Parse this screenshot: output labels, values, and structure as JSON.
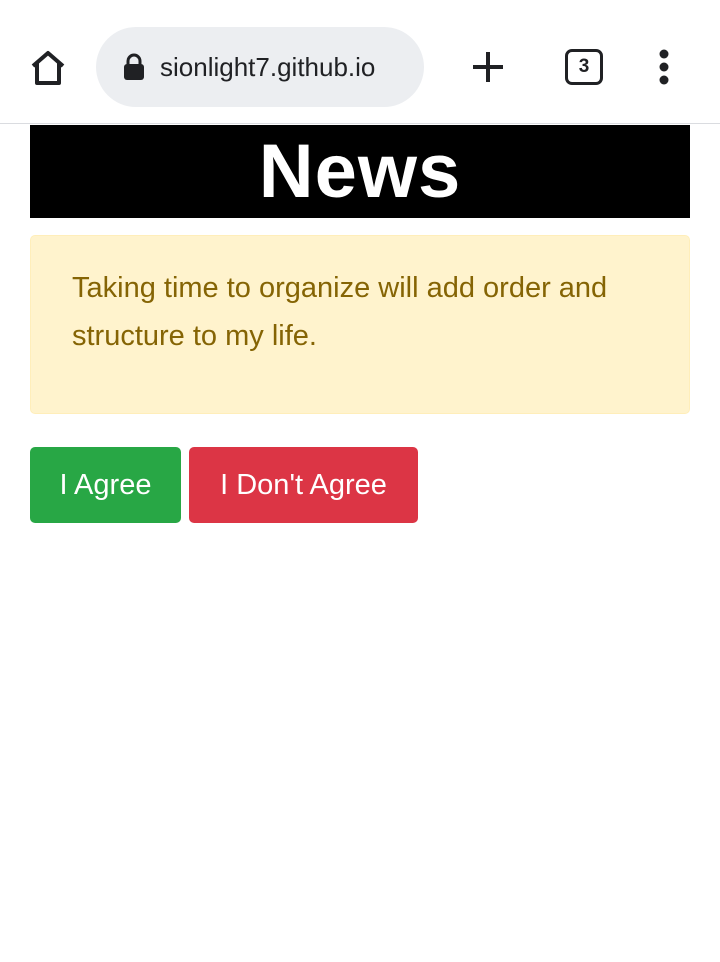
{
  "browser": {
    "url": "sionlight7.github.io",
    "tab_count": "3",
    "icons": {
      "home": "home-icon",
      "lock": "lock-icon",
      "new_tab": "plus-icon",
      "tabs": "tab-switcher-icon",
      "menu": "more-vert-icon"
    }
  },
  "page": {
    "banner_title": "News",
    "quote": "Taking time to organize will add order and structure to my life.",
    "buttons": {
      "agree_label": "I Agree",
      "disagree_label": "I Don't Agree"
    }
  },
  "colors": {
    "banner_bg": "#000000",
    "quote_bg": "#fff3cd",
    "quote_text": "#856404",
    "agree_bg": "#28a745",
    "disagree_bg": "#dc3545"
  }
}
